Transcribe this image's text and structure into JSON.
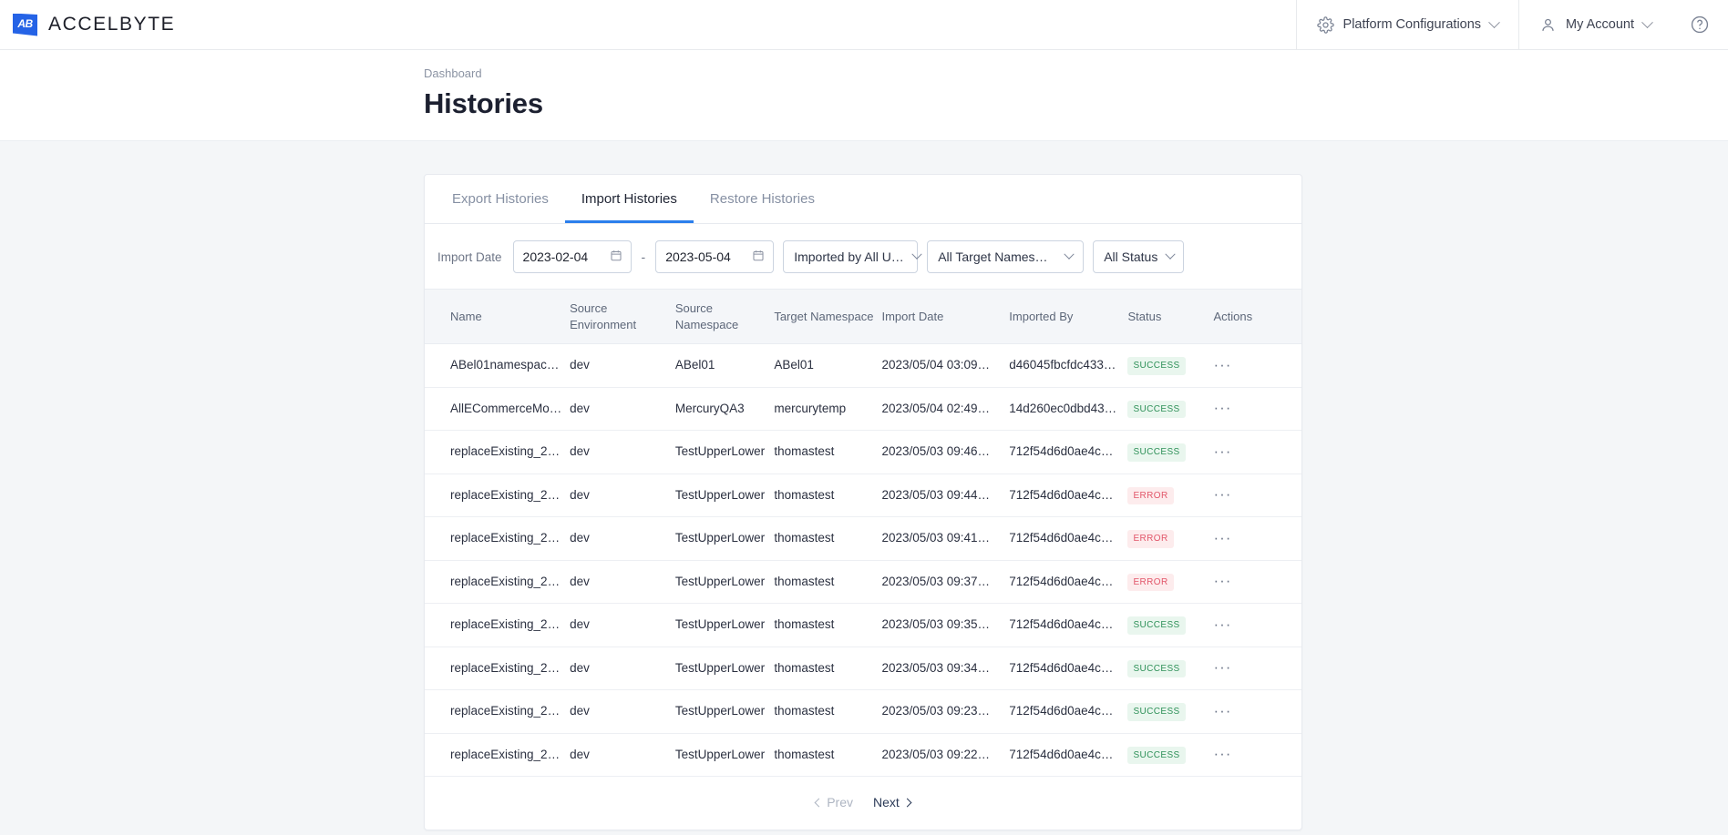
{
  "topbar": {
    "brand_initials": "AB",
    "brand_name": "ACCELBYTE",
    "platform_configurations": "Platform Configurations",
    "my_account": "My Account",
    "help_label": "?",
    "accent_color": "#2563e6"
  },
  "header": {
    "breadcrumb": "Dashboard",
    "title": "Histories"
  },
  "tabs": [
    {
      "label": "Export Histories",
      "active": false
    },
    {
      "label": "Import Histories",
      "active": true
    },
    {
      "label": "Restore Histories",
      "active": false
    }
  ],
  "filters": {
    "import_date_label": "Import Date",
    "date_from": "2023-02-04",
    "date_to": "2023-05-04",
    "range_separator": "-",
    "imported_by": "Imported by All U…",
    "target_namespace": "All Target Names…",
    "status": "All Status"
  },
  "table": {
    "columns": [
      "Name",
      "Source Environment",
      "Source Namespace",
      "Target Namespace",
      "Import Date",
      "Imported By",
      "Status",
      "Actions"
    ],
    "rows": [
      {
        "name": "ABel01namespac…",
        "source_environment": "dev",
        "source_namespace": "ABel01",
        "target_namespace": "ABel01",
        "import_date": "2023/05/04 03:09…",
        "imported_by": "d46045fbcfdc433…",
        "status": "SUCCESS",
        "actions": "···"
      },
      {
        "name": "AllECommerceMo…",
        "source_environment": "dev",
        "source_namespace": "MercuryQA3",
        "target_namespace": "mercurytemp",
        "import_date": "2023/05/04 02:49…",
        "imported_by": "14d260ec0dbd43…",
        "status": "SUCCESS",
        "actions": "···"
      },
      {
        "name": "replaceExisting_2…",
        "source_environment": "dev",
        "source_namespace": "TestUpperLower",
        "target_namespace": "thomastest",
        "import_date": "2023/05/03 09:46…",
        "imported_by": "712f54d6d0ae4c…",
        "status": "SUCCESS",
        "actions": "···"
      },
      {
        "name": "replaceExisting_2…",
        "source_environment": "dev",
        "source_namespace": "TestUpperLower",
        "target_namespace": "thomastest",
        "import_date": "2023/05/03 09:44…",
        "imported_by": "712f54d6d0ae4c…",
        "status": "ERROR",
        "actions": "···"
      },
      {
        "name": "replaceExisting_2…",
        "source_environment": "dev",
        "source_namespace": "TestUpperLower",
        "target_namespace": "thomastest",
        "import_date": "2023/05/03 09:41…",
        "imported_by": "712f54d6d0ae4c…",
        "status": "ERROR",
        "actions": "···"
      },
      {
        "name": "replaceExisting_2…",
        "source_environment": "dev",
        "source_namespace": "TestUpperLower",
        "target_namespace": "thomastest",
        "import_date": "2023/05/03 09:37…",
        "imported_by": "712f54d6d0ae4c…",
        "status": "ERROR",
        "actions": "···"
      },
      {
        "name": "replaceExisting_2…",
        "source_environment": "dev",
        "source_namespace": "TestUpperLower",
        "target_namespace": "thomastest",
        "import_date": "2023/05/03 09:35…",
        "imported_by": "712f54d6d0ae4c…",
        "status": "SUCCESS",
        "actions": "···"
      },
      {
        "name": "replaceExisting_2…",
        "source_environment": "dev",
        "source_namespace": "TestUpperLower",
        "target_namespace": "thomastest",
        "import_date": "2023/05/03 09:34…",
        "imported_by": "712f54d6d0ae4c…",
        "status": "SUCCESS",
        "actions": "···"
      },
      {
        "name": "replaceExisting_2…",
        "source_environment": "dev",
        "source_namespace": "TestUpperLower",
        "target_namespace": "thomastest",
        "import_date": "2023/05/03 09:23…",
        "imported_by": "712f54d6d0ae4c…",
        "status": "SUCCESS",
        "actions": "···"
      },
      {
        "name": "replaceExisting_2…",
        "source_environment": "dev",
        "source_namespace": "TestUpperLower",
        "target_namespace": "thomastest",
        "import_date": "2023/05/03 09:22…",
        "imported_by": "712f54d6d0ae4c…",
        "status": "SUCCESS",
        "actions": "···"
      }
    ]
  },
  "pagination": {
    "prev": "Prev",
    "next": "Next"
  },
  "colors": {
    "tab_active": "#2b7fec",
    "success_text": "#2f9159",
    "success_bg": "#e9f6ee",
    "error_text": "#e2566a",
    "error_bg": "#fdeced",
    "page_bg": "#f4f6f8"
  }
}
